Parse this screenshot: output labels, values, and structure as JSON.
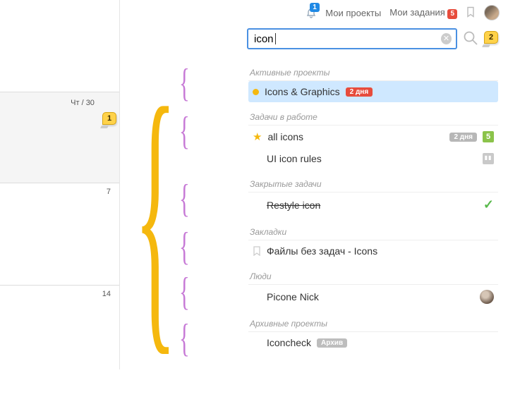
{
  "toolbar": {
    "notif_count": "1",
    "my_projects": "Мои проекты",
    "my_tasks": "Мои задания",
    "tasks_badge": "5"
  },
  "search": {
    "value": "icon",
    "annot": "2"
  },
  "calendar": {
    "day_big": "Чт / 30",
    "day_mid": "7",
    "day_bot": "14",
    "annot": "1"
  },
  "sections": {
    "active_projects": "Активные проекты",
    "tasks_in_work": "Задачи в работе",
    "closed_tasks": "Закрытые задачи",
    "bookmarks": "Закладки",
    "people": "Люди",
    "archived_projects": "Архивные проекты"
  },
  "results": {
    "project_name": "Icons & Graphics",
    "project_tag": "2 дня",
    "task1": "all icons",
    "task1_tag": "2 дня",
    "task1_count": "5",
    "task2": "UI icon rules",
    "closed1": "Restyle icon",
    "bookmark1": "Файлы без задач - Icons",
    "person1": "Picone Nick",
    "arch1": "Iconcheck",
    "arch_tag": "Архив"
  }
}
